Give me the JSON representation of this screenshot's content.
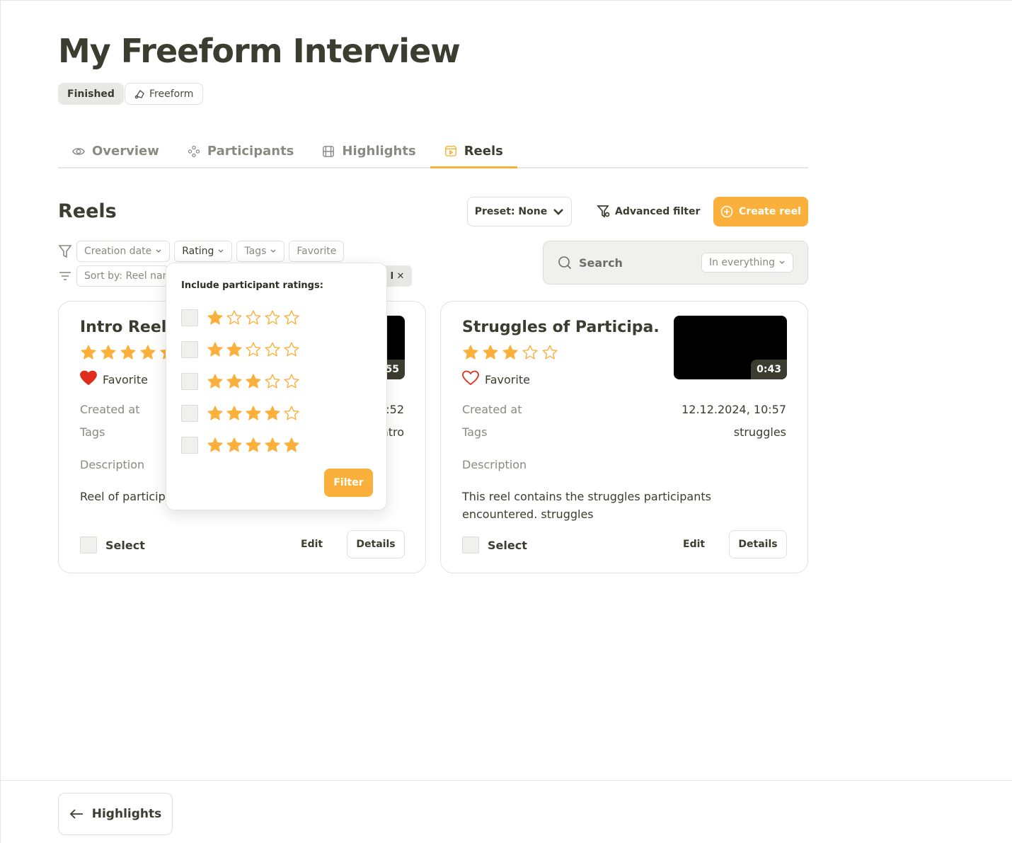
{
  "page": {
    "title": "My Freeform Interview"
  },
  "badges": {
    "status": "Finished",
    "type": "Freeform"
  },
  "tabs": [
    {
      "label": "Overview",
      "icon": "eye-icon"
    },
    {
      "label": "Participants",
      "icon": "participants-icon"
    },
    {
      "label": "Highlights",
      "icon": "film-icon"
    },
    {
      "label": "Reels",
      "icon": "reel-icon",
      "active": true
    }
  ],
  "toolbar": {
    "section_title": "Reels",
    "preset_label": "Preset: None",
    "advanced_filter_label": "Advanced filter",
    "create_label": "Create reel"
  },
  "filters": {
    "creation_date": "Creation date",
    "rating": "Rating",
    "tags": "Tags",
    "favorite": "Favorite",
    "sort_label": "Sort by: Reel name",
    "clear_label": "l ✕"
  },
  "search": {
    "label": "Search",
    "scope": "In everything"
  },
  "reels": [
    {
      "title": "Intro Reel",
      "rating": 5,
      "favorite": true,
      "favorite_label": "Favorite",
      "duration": "0:55",
      "created_label": "Created at",
      "created_value": ":52",
      "tags_label": "Tags",
      "tags_value": "ntro",
      "description_label": "Description",
      "description": "Reel of participants",
      "select_label": "Select",
      "edit_label": "Edit",
      "details_label": "Details"
    },
    {
      "title": "Struggles of Participa...",
      "rating": 3,
      "favorite": false,
      "favorite_label": "Favorite",
      "duration": "0:43",
      "created_label": "Created at",
      "created_value": "12.12.2024, 10:57",
      "tags_label": "Tags",
      "tags_value": "struggles",
      "description_label": "Description",
      "description": "This reel contains the struggles participants encountered. struggles",
      "select_label": "Select",
      "edit_label": "Edit",
      "details_label": "Details"
    }
  ],
  "rating_popup": {
    "title": "Include participant ratings:",
    "options": [
      1,
      2,
      3,
      4,
      5
    ],
    "filter_label": "Filter"
  },
  "footer": {
    "back_label": "Highlights"
  },
  "colors": {
    "accent": "#fbb03b",
    "heart": "#e02d1b",
    "text": "#3c3c30"
  }
}
